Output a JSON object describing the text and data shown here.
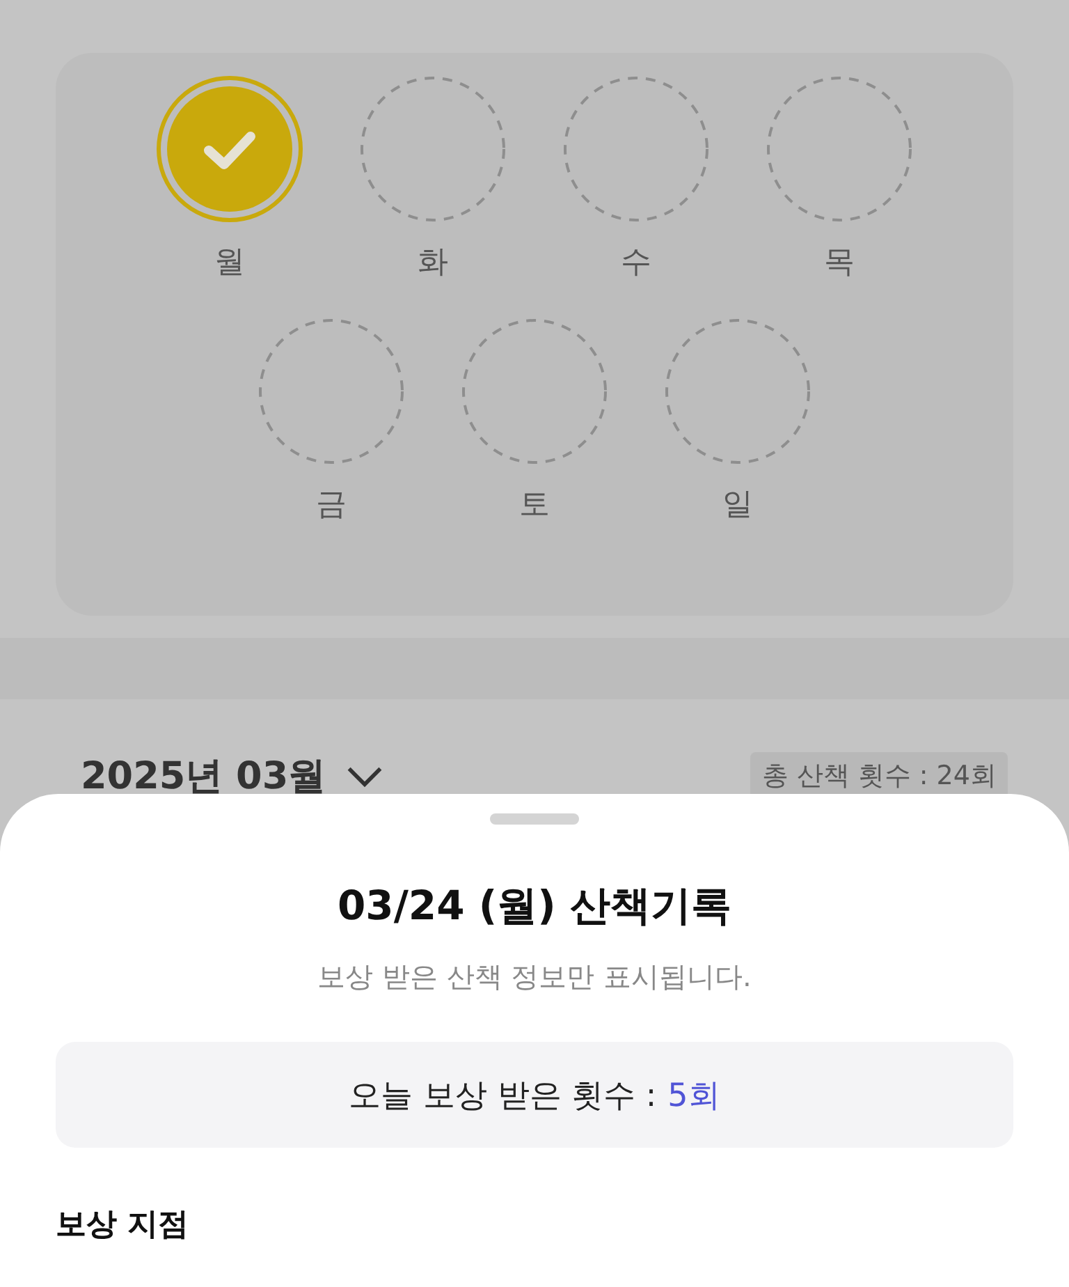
{
  "days": [
    {
      "label": "월",
      "checked": true
    },
    {
      "label": "화",
      "checked": false
    },
    {
      "label": "수",
      "checked": false
    },
    {
      "label": "목",
      "checked": false
    },
    {
      "label": "금",
      "checked": false
    },
    {
      "label": "토",
      "checked": false
    },
    {
      "label": "일",
      "checked": false
    }
  ],
  "month": {
    "label": "2025년 03월"
  },
  "total_badge": "총 산책 횟수 : 24회",
  "sheet": {
    "title": "03/24 (월) 산책기록",
    "subtitle": "보상 받은 산책 정보만 표시됩니다.",
    "reward_count": {
      "label": "오늘 보상 받은 횟수 :",
      "value": "5회"
    },
    "section_title": "보상 지점"
  }
}
